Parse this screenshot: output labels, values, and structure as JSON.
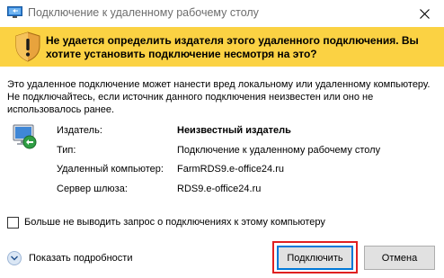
{
  "window": {
    "title": "Подключение к удаленному рабочему столу",
    "close_glyph": "✕"
  },
  "banner": {
    "text": "Не удается определить издателя этого удаленного подключения. Вы хотите установить подключение несмотря на это?",
    "color": "#fbd243"
  },
  "description": "Это удаленное подключение может нанести вред локальному или удаленному компьютеру. Не подключайтесь, если источник данного подключения неизвестен или оно не использовалось ранее.",
  "info": {
    "publisher_label": "Издатель:",
    "publisher_value": "Неизвестный издатель",
    "type_label": "Тип:",
    "type_value": "Подключение к удаленному рабочему столу",
    "remote_label": "Удаленный компьютер:",
    "remote_value": "FarmRDS9.e-office24.ru",
    "gateway_label": "Сервер шлюза:",
    "gateway_value": "RDS9.e-office24.ru"
  },
  "checkbox": {
    "label": "Больше не выводить запрос о подключениях к этому компьютеру",
    "checked": false
  },
  "footer": {
    "details_label": "Показать подробности",
    "connect_label": "Подключить",
    "cancel_label": "Отмена",
    "highlight_color": "#e02020"
  }
}
